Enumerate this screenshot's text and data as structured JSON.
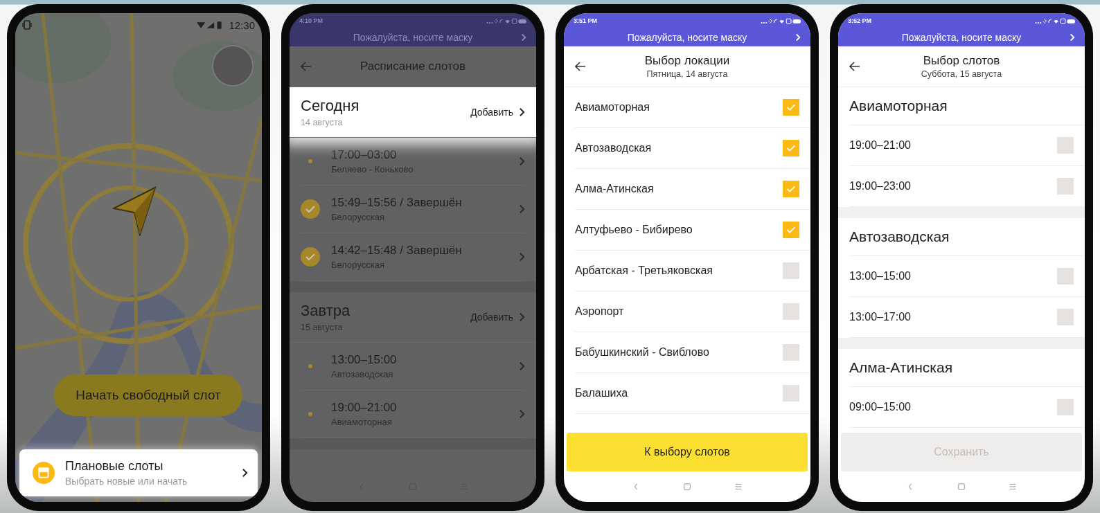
{
  "phones": [
    {
      "kind": "map",
      "dimmed": true,
      "status_time": "12:30",
      "start_button": "Начать свободный слот",
      "card": {
        "title": "Плановые слоты",
        "subtitle": "Выбрать новые или начать",
        "highlighted": true
      }
    },
    {
      "kind": "schedule",
      "dimmed": true,
      "status_time": "4:10 PM",
      "banner": "Пожалуйста, носите маску",
      "title": "Расписание слотов",
      "sections": [
        {
          "title": "Сегодня",
          "date": "14 августа",
          "action": "Добавить",
          "highlighted": true,
          "slots": [
            {
              "time": "17:00–03:00",
              "place": "Беляево - Коньково",
              "completed": false
            },
            {
              "time": "15:49–15:56 / Завершён",
              "place": "Белорусская",
              "completed": true
            },
            {
              "time": "14:42–15:48 / Завершён",
              "place": "Белорусская",
              "completed": true
            }
          ]
        },
        {
          "title": "Завтра",
          "date": "15 августа",
          "action": "Добавить",
          "highlighted": false,
          "slots": [
            {
              "time": "13:00–15:00",
              "place": "Автозаводская",
              "completed": false
            },
            {
              "time": "19:00–21:00",
              "place": "Авиамоторная",
              "completed": false
            }
          ]
        }
      ]
    },
    {
      "kind": "locations",
      "dimmed": false,
      "status_time": "3:51 PM",
      "banner": "Пожалуйста, носите маску",
      "title": "Выбор локации",
      "subtitle": "Пятница, 14 августа",
      "locations": [
        {
          "name": "Авиамоторная",
          "checked": true
        },
        {
          "name": "Автозаводская",
          "checked": true
        },
        {
          "name": "Алма-Атинская",
          "checked": true
        },
        {
          "name": "Алтуфьево - Бибирево",
          "checked": true
        },
        {
          "name": "Арбатская - Третьяковская",
          "checked": false
        },
        {
          "name": "Аэропорт",
          "checked": false
        },
        {
          "name": "Бабушкинский - Свиблово",
          "checked": false
        },
        {
          "name": "Балашиха",
          "checked": false
        }
      ],
      "button": {
        "label": "К выбору слотов",
        "disabled": false
      }
    },
    {
      "kind": "slots",
      "dimmed": false,
      "status_time": "3:52 PM",
      "banner": "Пожалуйста, носите маску",
      "title": "Выбор слотов",
      "subtitle": "Суббота, 15 августа",
      "groups": [
        {
          "name": "Авиамоторная",
          "slots": [
            {
              "time": "19:00–21:00",
              "checked": false
            },
            {
              "time": "19:00–23:00",
              "checked": false
            }
          ]
        },
        {
          "name": "Автозаводская",
          "slots": [
            {
              "time": "13:00–15:00",
              "checked": false
            },
            {
              "time": "13:00–17:00",
              "checked": false
            }
          ]
        },
        {
          "name": "Алма-Атинская",
          "slots": [
            {
              "time": "09:00–15:00",
              "checked": false
            }
          ]
        }
      ],
      "button": {
        "label": "Сохранить",
        "disabled": true
      }
    }
  ]
}
